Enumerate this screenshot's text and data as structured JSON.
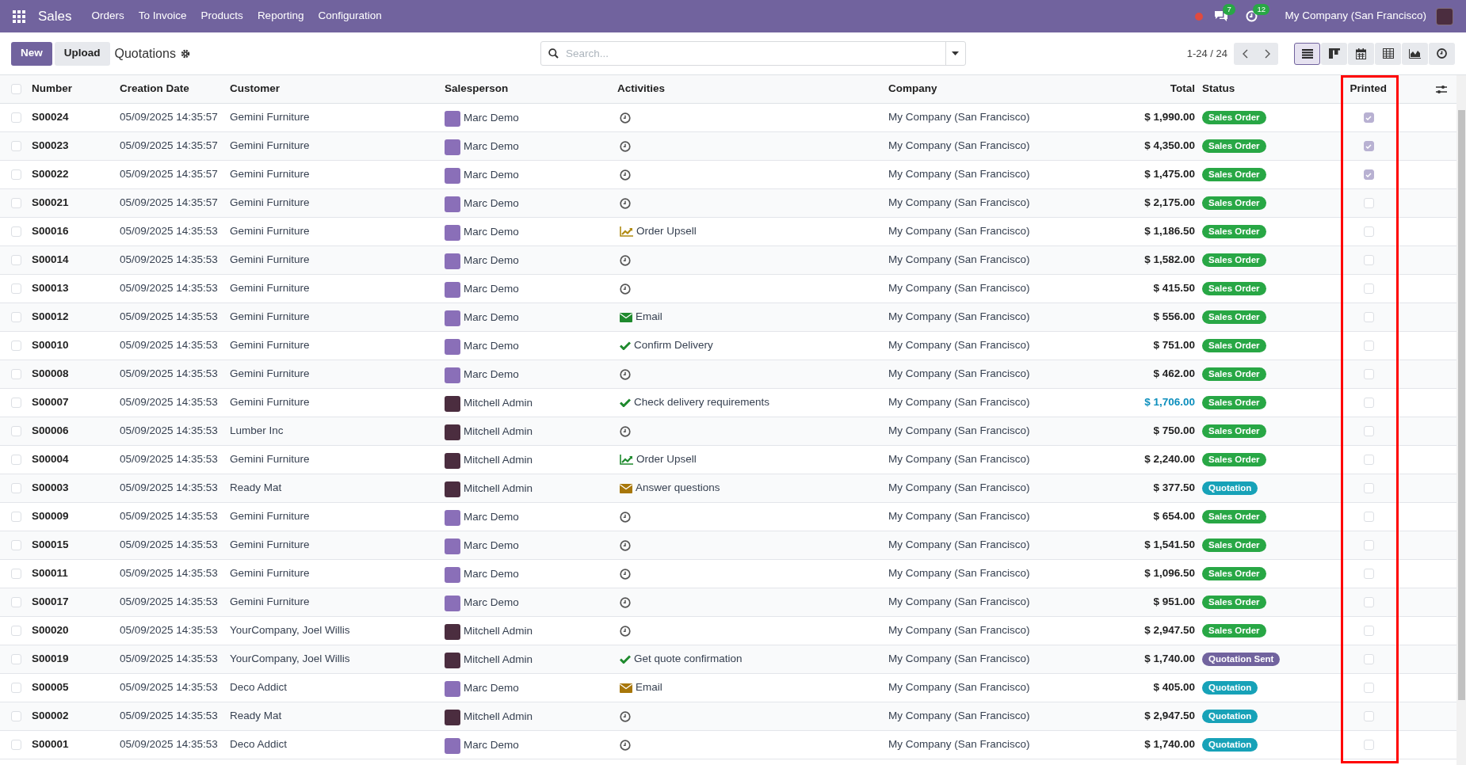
{
  "navbar": {
    "app": "Sales",
    "menu": [
      "Orders",
      "To Invoice",
      "Products",
      "Reporting",
      "Configuration"
    ],
    "messages_badge": "7",
    "activities_badge": "12",
    "company": "My Company (San Francisco)"
  },
  "control_panel": {
    "new_button": "New",
    "upload_button": "Upload",
    "breadcrumb": "Quotations",
    "search": {
      "placeholder": "Search..."
    },
    "pager": "1-24 / 24",
    "views": [
      {
        "kind": "list",
        "selected": true
      },
      {
        "kind": "kanban",
        "selected": false
      },
      {
        "kind": "calendar",
        "selected": false
      },
      {
        "kind": "pivot",
        "selected": false
      },
      {
        "kind": "graph",
        "selected": false
      },
      {
        "kind": "activity",
        "selected": false
      }
    ]
  },
  "table": {
    "columns": [
      "Number",
      "Creation Date",
      "Customer",
      "Salesperson",
      "Activities",
      "Company",
      "Total",
      "Status",
      "Printed"
    ],
    "all_selected": false,
    "printed_column_marked": true,
    "rows": [
      {
        "selected": false,
        "number": "S00024",
        "date": "05/09/2025 14:35:57",
        "customer": "Gemini Furniture",
        "salesperson": {
          "name": "Marc Demo",
          "color": "#8a6fb8"
        },
        "activity": {
          "kind": "none"
        },
        "company": "My Company (San Francisco)",
        "total": "$ 1,990.00",
        "total_highlighted": false,
        "status": {
          "label": "Sales Order",
          "kind": "sale"
        },
        "printed": true
      },
      {
        "selected": false,
        "number": "S00023",
        "date": "05/09/2025 14:35:57",
        "customer": "Gemini Furniture",
        "salesperson": {
          "name": "Marc Demo",
          "color": "#8a6fb8"
        },
        "activity": {
          "kind": "none"
        },
        "company": "My Company (San Francisco)",
        "total": "$ 4,350.00",
        "total_highlighted": false,
        "status": {
          "label": "Sales Order",
          "kind": "sale"
        },
        "printed": true
      },
      {
        "selected": false,
        "number": "S00022",
        "date": "05/09/2025 14:35:57",
        "customer": "Gemini Furniture",
        "salesperson": {
          "name": "Marc Demo",
          "color": "#8a6fb8"
        },
        "activity": {
          "kind": "none"
        },
        "company": "My Company (San Francisco)",
        "total": "$ 1,475.00",
        "total_highlighted": false,
        "status": {
          "label": "Sales Order",
          "kind": "sale"
        },
        "printed": true
      },
      {
        "selected": false,
        "number": "S00021",
        "date": "05/09/2025 14:35:57",
        "customer": "Gemini Furniture",
        "salesperson": {
          "name": "Marc Demo",
          "color": "#8a6fb8"
        },
        "activity": {
          "kind": "none"
        },
        "company": "My Company (San Francisco)",
        "total": "$ 2,175.00",
        "total_highlighted": false,
        "status": {
          "label": "Sales Order",
          "kind": "sale"
        },
        "printed": false
      },
      {
        "selected": false,
        "number": "S00016",
        "date": "05/09/2025 14:35:53",
        "customer": "Gemini Furniture",
        "salesperson": {
          "name": "Marc Demo",
          "color": "#8a6fb8"
        },
        "activity": {
          "kind": "upsell",
          "label": "Order Upsell",
          "color": "#b08a12"
        },
        "company": "My Company (San Francisco)",
        "total": "$ 1,186.50",
        "total_highlighted": false,
        "status": {
          "label": "Sales Order",
          "kind": "sale"
        },
        "printed": false
      },
      {
        "selected": false,
        "number": "S00014",
        "date": "05/09/2025 14:35:53",
        "customer": "Gemini Furniture",
        "salesperson": {
          "name": "Marc Demo",
          "color": "#8a6fb8"
        },
        "activity": {
          "kind": "none"
        },
        "company": "My Company (San Francisco)",
        "total": "$ 1,582.00",
        "total_highlighted": false,
        "status": {
          "label": "Sales Order",
          "kind": "sale"
        },
        "printed": false
      },
      {
        "selected": false,
        "number": "S00013",
        "date": "05/09/2025 14:35:53",
        "customer": "Gemini Furniture",
        "salesperson": {
          "name": "Marc Demo",
          "color": "#8a6fb8"
        },
        "activity": {
          "kind": "none"
        },
        "company": "My Company (San Francisco)",
        "total": "$ 415.50",
        "total_highlighted": false,
        "status": {
          "label": "Sales Order",
          "kind": "sale"
        },
        "printed": false
      },
      {
        "selected": false,
        "number": "S00012",
        "date": "05/09/2025 14:35:53",
        "customer": "Gemini Furniture",
        "salesperson": {
          "name": "Marc Demo",
          "color": "#8a6fb8"
        },
        "activity": {
          "kind": "email",
          "label": "Email",
          "color": "#1f8a2e"
        },
        "company": "My Company (San Francisco)",
        "total": "$ 556.00",
        "total_highlighted": false,
        "status": {
          "label": "Sales Order",
          "kind": "sale"
        },
        "printed": false
      },
      {
        "selected": false,
        "number": "S00010",
        "date": "05/09/2025 14:35:53",
        "customer": "Gemini Furniture",
        "salesperson": {
          "name": "Marc Demo",
          "color": "#8a6fb8"
        },
        "activity": {
          "kind": "todo",
          "label": "Confirm Delivery",
          "color": "#1f8a2e"
        },
        "company": "My Company (San Francisco)",
        "total": "$ 751.00",
        "total_highlighted": false,
        "status": {
          "label": "Sales Order",
          "kind": "sale"
        },
        "printed": false
      },
      {
        "selected": false,
        "number": "S00008",
        "date": "05/09/2025 14:35:53",
        "customer": "Gemini Furniture",
        "salesperson": {
          "name": "Marc Demo",
          "color": "#8a6fb8"
        },
        "activity": {
          "kind": "none"
        },
        "company": "My Company (San Francisco)",
        "total": "$ 462.00",
        "total_highlighted": false,
        "status": {
          "label": "Sales Order",
          "kind": "sale"
        },
        "printed": false
      },
      {
        "selected": false,
        "number": "S00007",
        "date": "05/09/2025 14:35:53",
        "customer": "Gemini Furniture",
        "salesperson": {
          "name": "Mitchell Admin",
          "color": "#4b2d3f"
        },
        "activity": {
          "kind": "todo",
          "label": "Check delivery requirements",
          "color": "#1f8a2e"
        },
        "company": "My Company (San Francisco)",
        "total": "$ 1,706.00",
        "total_highlighted": true,
        "status": {
          "label": "Sales Order",
          "kind": "sale"
        },
        "printed": false
      },
      {
        "selected": false,
        "number": "S00006",
        "date": "05/09/2025 14:35:53",
        "customer": "Lumber Inc",
        "salesperson": {
          "name": "Mitchell Admin",
          "color": "#4b2d3f"
        },
        "activity": {
          "kind": "none"
        },
        "company": "My Company (San Francisco)",
        "total": "$ 750.00",
        "total_highlighted": false,
        "status": {
          "label": "Sales Order",
          "kind": "sale"
        },
        "printed": false
      },
      {
        "selected": false,
        "number": "S00004",
        "date": "05/09/2025 14:35:53",
        "customer": "Gemini Furniture",
        "salesperson": {
          "name": "Mitchell Admin",
          "color": "#4b2d3f"
        },
        "activity": {
          "kind": "upsell",
          "label": "Order Upsell",
          "color": "#1f8a2e"
        },
        "company": "My Company (San Francisco)",
        "total": "$ 2,240.00",
        "total_highlighted": false,
        "status": {
          "label": "Sales Order",
          "kind": "sale"
        },
        "printed": false
      },
      {
        "selected": false,
        "number": "S00003",
        "date": "05/09/2025 14:35:53",
        "customer": "Ready Mat",
        "salesperson": {
          "name": "Mitchell Admin",
          "color": "#4b2d3f"
        },
        "activity": {
          "kind": "email",
          "label": "Answer questions",
          "color": "#a8770a"
        },
        "company": "My Company (San Francisco)",
        "total": "$ 377.50",
        "total_highlighted": false,
        "status": {
          "label": "Quotation",
          "kind": "draft"
        },
        "printed": false
      },
      {
        "selected": false,
        "number": "S00009",
        "date": "05/09/2025 14:35:53",
        "customer": "Gemini Furniture",
        "salesperson": {
          "name": "Marc Demo",
          "color": "#8a6fb8"
        },
        "activity": {
          "kind": "none"
        },
        "company": "My Company (San Francisco)",
        "total": "$ 654.00",
        "total_highlighted": false,
        "status": {
          "label": "Sales Order",
          "kind": "sale"
        },
        "printed": false
      },
      {
        "selected": false,
        "number": "S00015",
        "date": "05/09/2025 14:35:53",
        "customer": "Gemini Furniture",
        "salesperson": {
          "name": "Marc Demo",
          "color": "#8a6fb8"
        },
        "activity": {
          "kind": "none"
        },
        "company": "My Company (San Francisco)",
        "total": "$ 1,541.50",
        "total_highlighted": false,
        "status": {
          "label": "Sales Order",
          "kind": "sale"
        },
        "printed": false
      },
      {
        "selected": false,
        "number": "S00011",
        "date": "05/09/2025 14:35:53",
        "customer": "Gemini Furniture",
        "salesperson": {
          "name": "Marc Demo",
          "color": "#8a6fb8"
        },
        "activity": {
          "kind": "none"
        },
        "company": "My Company (San Francisco)",
        "total": "$ 1,096.50",
        "total_highlighted": false,
        "status": {
          "label": "Sales Order",
          "kind": "sale"
        },
        "printed": false
      },
      {
        "selected": false,
        "number": "S00017",
        "date": "05/09/2025 14:35:53",
        "customer": "Gemini Furniture",
        "salesperson": {
          "name": "Marc Demo",
          "color": "#8a6fb8"
        },
        "activity": {
          "kind": "none"
        },
        "company": "My Company (San Francisco)",
        "total": "$ 951.00",
        "total_highlighted": false,
        "status": {
          "label": "Sales Order",
          "kind": "sale"
        },
        "printed": false
      },
      {
        "selected": false,
        "number": "S00020",
        "date": "05/09/2025 14:35:53",
        "customer": "YourCompany, Joel Willis",
        "salesperson": {
          "name": "Mitchell Admin",
          "color": "#4b2d3f"
        },
        "activity": {
          "kind": "none"
        },
        "company": "My Company (San Francisco)",
        "total": "$ 2,947.50",
        "total_highlighted": false,
        "status": {
          "label": "Sales Order",
          "kind": "sale"
        },
        "printed": false
      },
      {
        "selected": false,
        "number": "S00019",
        "date": "05/09/2025 14:35:53",
        "customer": "YourCompany, Joel Willis",
        "salesperson": {
          "name": "Mitchell Admin",
          "color": "#4b2d3f"
        },
        "activity": {
          "kind": "todo",
          "label": "Get quote confirmation",
          "color": "#1f8a2e"
        },
        "company": "My Company (San Francisco)",
        "total": "$ 1,740.00",
        "total_highlighted": false,
        "status": {
          "label": "Quotation Sent",
          "kind": "sent"
        },
        "printed": false
      },
      {
        "selected": false,
        "number": "S00005",
        "date": "05/09/2025 14:35:53",
        "customer": "Deco Addict",
        "salesperson": {
          "name": "Marc Demo",
          "color": "#8a6fb8"
        },
        "activity": {
          "kind": "email",
          "label": "Email",
          "color": "#a8770a"
        },
        "company": "My Company (San Francisco)",
        "total": "$ 405.00",
        "total_highlighted": false,
        "status": {
          "label": "Quotation",
          "kind": "draft"
        },
        "printed": false
      },
      {
        "selected": false,
        "number": "S00002",
        "date": "05/09/2025 14:35:53",
        "customer": "Ready Mat",
        "salesperson": {
          "name": "Mitchell Admin",
          "color": "#4b2d3f"
        },
        "activity": {
          "kind": "none"
        },
        "company": "My Company (San Francisco)",
        "total": "$ 2,947.50",
        "total_highlighted": false,
        "status": {
          "label": "Quotation",
          "kind": "draft"
        },
        "printed": false
      },
      {
        "selected": false,
        "number": "S00001",
        "date": "05/09/2025 14:35:53",
        "customer": "Deco Addict",
        "salesperson": {
          "name": "Marc Demo",
          "color": "#8a6fb8"
        },
        "activity": {
          "kind": "none"
        },
        "company": "My Company (San Francisco)",
        "total": "$ 1,740.00",
        "total_highlighted": false,
        "status": {
          "label": "Quotation",
          "kind": "draft"
        },
        "printed": false
      }
    ]
  }
}
